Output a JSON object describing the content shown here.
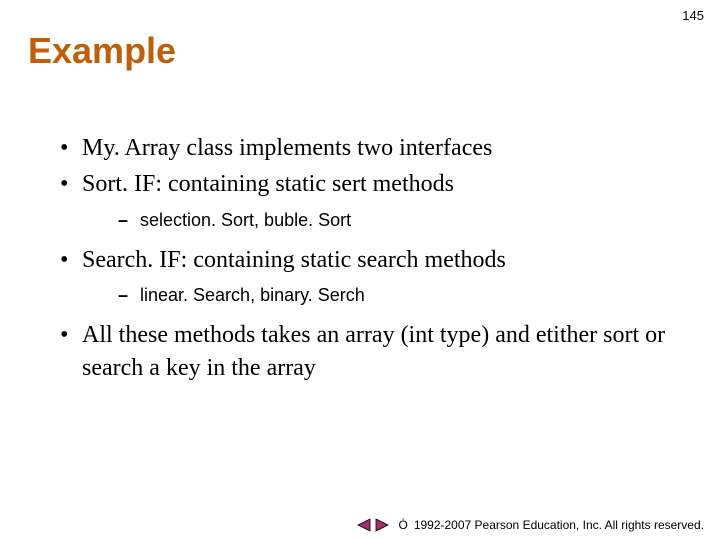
{
  "page_number": "145",
  "title": "Example",
  "bullets": [
    {
      "level": 1,
      "text": "My. Array class implements two interfaces"
    },
    {
      "level": 1,
      "text": "Sort. IF: containing static sert methods"
    },
    {
      "level": 2,
      "text": "selection. Sort, buble. Sort"
    },
    {
      "level": 1,
      "text": "Search. IF: containing static search methods"
    },
    {
      "level": 2,
      "text": "linear. Search, binary. Serch"
    },
    {
      "level": 1,
      "text": "All these methods takes an array (int type) and etither sort or search a key in the array"
    }
  ],
  "footer": {
    "copyright_symbol": "Ó",
    "text": "1992-2007 Pearson Education, Inc.  All rights reserved."
  },
  "colors": {
    "title": "#c05f05",
    "nav_arrow": "#ab2b69"
  }
}
